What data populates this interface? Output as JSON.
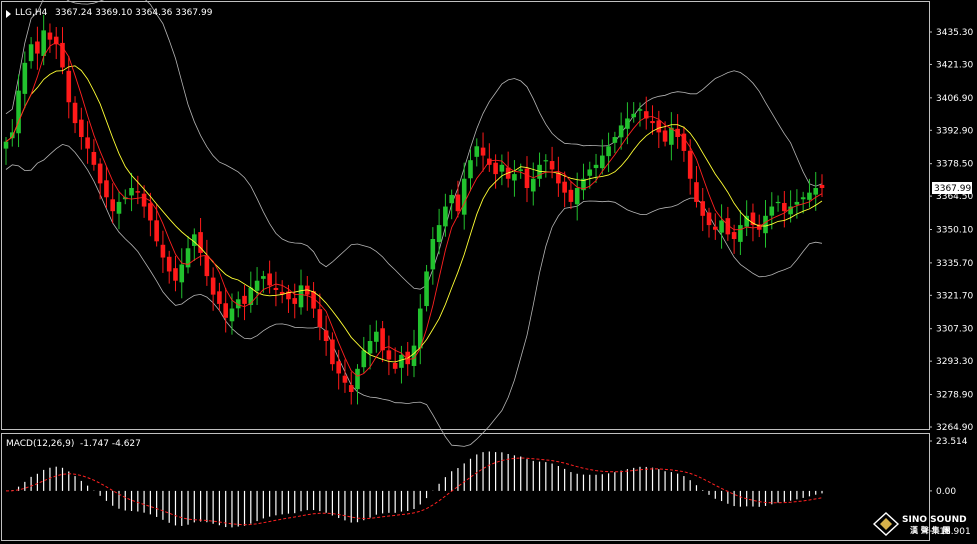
{
  "header": {
    "symbol": "LLG,H4",
    "ohlc": "3367.24 3369.10 3364.36 3367.99"
  },
  "macd_header": {
    "label": "MACD(12,26,9)",
    "values": "-1.747 -4.627"
  },
  "current_price_label": "3367.99",
  "logo": {
    "name": "SINO SOUND",
    "cn": "漢 聲 集 團"
  },
  "colors": {
    "background": "#000000",
    "bull": "#22c22e",
    "bear": "#ff1a1a",
    "band": "#b4b4b4",
    "ma_fast": "#ff2020",
    "ma_slow": "#ffff33",
    "macd_hist": "#ffffff",
    "macd_signal": "#ff2020",
    "frame": "#c0c0c0"
  },
  "chart_data": [
    {
      "type": "candlestick",
      "title": "",
      "ylim": [
        3264.9,
        3435.3
      ],
      "yticks": [
        3435.3,
        3421.3,
        3406.9,
        3392.9,
        3378.5,
        3364.5,
        3350.1,
        3335.7,
        3321.7,
        3307.3,
        3293.3,
        3278.9,
        3264.9
      ],
      "ytick_labels": [
        "3435.30",
        "3421.30",
        "3406.90",
        "3392.90",
        "3378.50",
        "3364.50",
        "3350.10",
        "3335.70",
        "3321.70",
        "3307.30",
        "3293.30",
        "3278.90",
        "3264.90"
      ],
      "current_price": 3367.99,
      "overlays": [
        "bollinger-bands",
        "ma-fast",
        "ma-slow"
      ],
      "closes": [
        3388,
        3392,
        3410,
        3422,
        3430,
        3426,
        3436,
        3432,
        3430,
        3420,
        3405,
        3396,
        3390,
        3385,
        3378,
        3370,
        3364,
        3358,
        3362,
        3364,
        3368,
        3366,
        3360,
        3354,
        3345,
        3338,
        3332,
        3328,
        3335,
        3342,
        3348,
        3340,
        3330,
        3322,
        3318,
        3312,
        3316,
        3320,
        3318,
        3325,
        3328,
        3330,
        3326,
        3324,
        3322,
        3320,
        3318,
        3326,
        3322,
        3316,
        3308,
        3302,
        3292,
        3288,
        3284,
        3280,
        3290,
        3298,
        3302,
        3306,
        3298,
        3294,
        3290,
        3296,
        3292,
        3300,
        3316,
        3332,
        3346,
        3352,
        3360,
        3365,
        3358,
        3372,
        3380,
        3386,
        3382,
        3378,
        3374,
        3378,
        3372,
        3374,
        3376,
        3368,
        3372,
        3378,
        3380,
        3376,
        3370,
        3366,
        3362,
        3368,
        3372,
        3376,
        3378,
        3382,
        3386,
        3390,
        3395,
        3398,
        3400,
        3402,
        3398,
        3396,
        3392,
        3388,
        3394,
        3390,
        3384,
        3372,
        3362,
        3356,
        3352,
        3350,
        3354,
        3348,
        3346,
        3352,
        3356,
        3352,
        3350,
        3356,
        3360,
        3362,
        3358,
        3360,
        3362,
        3364,
        3366,
        3368,
        3368
      ],
      "bollinger": {
        "upper_range": [
          3350,
          3440
        ],
        "lower_range": [
          3264,
          3356
        ]
      }
    },
    {
      "type": "histogram",
      "title": "",
      "name": "MACD(12,26,9)",
      "ylim": [
        -18.901,
        23.514
      ],
      "yticks": [
        23.514,
        0.0,
        -18.901
      ],
      "ytick_labels": [
        "23.514",
        "0.00",
        "-18.901"
      ],
      "macd_value": -1.747,
      "signal_value": -4.627
    }
  ]
}
